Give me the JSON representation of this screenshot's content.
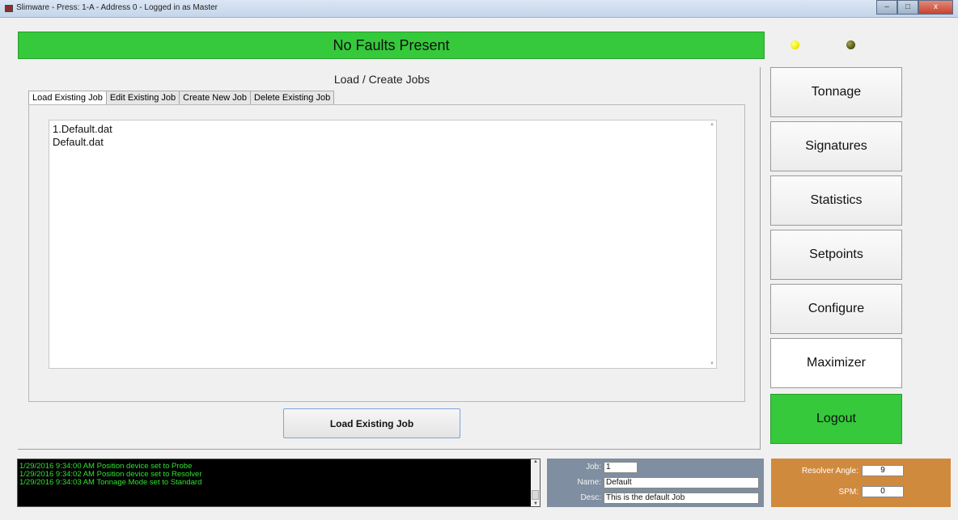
{
  "window": {
    "title": "Slimware - Press: 1-A - Address 0 - Logged in as Master",
    "minimize": "–",
    "maximize": "□",
    "close": "x"
  },
  "fault_status": {
    "text": "No Faults Present",
    "color": "#35c93b"
  },
  "indicators": [
    {
      "name": "yellow-led",
      "color": "#f0f000"
    },
    {
      "name": "olive-led",
      "color": "#5a5a12"
    }
  ],
  "main": {
    "title": "Load / Create Jobs",
    "tabs": [
      {
        "label": "Load Existing Job",
        "active": true
      },
      {
        "label": "Edit Existing Job",
        "active": false
      },
      {
        "label": "Create New Job",
        "active": false
      },
      {
        "label": "Delete Existing Job",
        "active": false
      }
    ],
    "files": [
      "1.Default.dat",
      "Default.dat"
    ],
    "load_button": "Load Existing Job"
  },
  "sidebar": {
    "buttons": [
      "Tonnage",
      "Signatures",
      "Statistics",
      "Setpoints",
      "Configure",
      "Maximizer",
      "Logout"
    ]
  },
  "log": {
    "lines": [
      "1/29/2016 9:34:00 AM  Position device set to Probe",
      "1/29/2016 9:34:02 AM  Position device set to Resolver",
      "1/29/2016 9:34:03 AM  Tonnage Mode set to Standard"
    ]
  },
  "job_info": {
    "job_label": "Job:",
    "job_value": "1",
    "name_label": "Name:",
    "name_value": "Default",
    "desc_label": "Desc:",
    "desc_value": "This is the default Job"
  },
  "status": {
    "resolver_label": "Resolver Angle:",
    "resolver_value": "9",
    "spm_label": "SPM:",
    "spm_value": "0"
  }
}
